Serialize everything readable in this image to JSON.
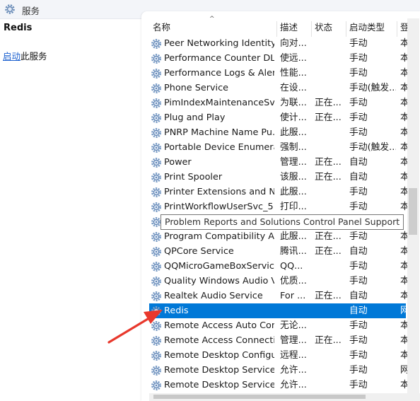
{
  "window": {
    "title": "服务"
  },
  "left": {
    "service_name": "Redis",
    "action_link": "启动",
    "action_suffix": "此服务"
  },
  "columns": {
    "name": "名称",
    "desc": "描述",
    "status": "状态",
    "startup": "启动类型",
    "logon": "登"
  },
  "rows": [
    {
      "name": "Peer Networking Identity...",
      "desc": "向对...",
      "status": "",
      "startup": "手动",
      "logon": "本"
    },
    {
      "name": "Performance Counter DL...",
      "desc": "使远...",
      "status": "",
      "startup": "手动",
      "logon": "本"
    },
    {
      "name": "Performance Logs & Aler...",
      "desc": "性能...",
      "status": "",
      "startup": "手动",
      "logon": "本"
    },
    {
      "name": "Phone Service",
      "desc": "在设...",
      "status": "",
      "startup": "手动(触发...",
      "logon": "本"
    },
    {
      "name": "PimIndexMaintenanceSvc...",
      "desc": "为联...",
      "status": "正在...",
      "startup": "手动",
      "logon": "本"
    },
    {
      "name": "Plug and Play",
      "desc": "使计...",
      "status": "正在...",
      "startup": "手动",
      "logon": "本"
    },
    {
      "name": "PNRP Machine Name Pu...",
      "desc": "此服...",
      "status": "",
      "startup": "手动",
      "logon": "本"
    },
    {
      "name": "Portable Device Enumera...",
      "desc": "强制...",
      "status": "",
      "startup": "手动(触发...",
      "logon": "本"
    },
    {
      "name": "Power",
      "desc": "管理...",
      "status": "正在...",
      "startup": "自动",
      "logon": "本"
    },
    {
      "name": "Print Spooler",
      "desc": "该服...",
      "status": "正在...",
      "startup": "自动",
      "logon": "本"
    },
    {
      "name": "Printer Extensions and N...",
      "desc": "此服...",
      "status": "",
      "startup": "手动",
      "logon": "本"
    },
    {
      "name": "PrintWorkflowUserSvc_51...",
      "desc": "打印...",
      "status": "",
      "startup": "手动",
      "logon": "本"
    },
    {
      "name": "",
      "desc": "",
      "status": "",
      "startup": "",
      "logon": ""
    },
    {
      "name": "Program Compatibility A...",
      "desc": "此服...",
      "status": "正在...",
      "startup": "手动",
      "logon": "本"
    },
    {
      "name": "QPCore Service",
      "desc": "腾讯...",
      "status": "正在...",
      "startup": "自动",
      "logon": "本"
    },
    {
      "name": "QQMicroGameBoxService",
      "desc": "QQ...",
      "status": "",
      "startup": "手动",
      "logon": "本"
    },
    {
      "name": "Quality Windows Audio V...",
      "desc": "优质...",
      "status": "",
      "startup": "手动",
      "logon": "本"
    },
    {
      "name": "Realtek Audio Service",
      "desc": "For ...",
      "status": "正在...",
      "startup": "自动",
      "logon": "本"
    },
    {
      "name": "Redis",
      "desc": "",
      "status": "",
      "startup": "自动",
      "logon": "网"
    },
    {
      "name": "Remote Access Auto Con...",
      "desc": "无论...",
      "status": "",
      "startup": "手动",
      "logon": "本"
    },
    {
      "name": "Remote Access Connecti...",
      "desc": "管理...",
      "status": "正在...",
      "startup": "手动",
      "logon": "本"
    },
    {
      "name": "Remote Desktop Configu...",
      "desc": "远程...",
      "status": "",
      "startup": "手动",
      "logon": "本"
    },
    {
      "name": "Remote Desktop Services",
      "desc": "允许...",
      "status": "",
      "startup": "手动",
      "logon": "网"
    },
    {
      "name": "Remote Desktop Service...",
      "desc": "允许...",
      "status": "",
      "startup": "手动",
      "logon": "本"
    }
  ],
  "tooltip": "Problem Reports and Solutions Control Panel Support",
  "colors": {
    "selection": "#0078d7",
    "annotation_arrow": "#e8382c",
    "link": "#1a5fcf"
  },
  "icons": {
    "header": "gear-icon",
    "service": "service-gear-icon"
  }
}
